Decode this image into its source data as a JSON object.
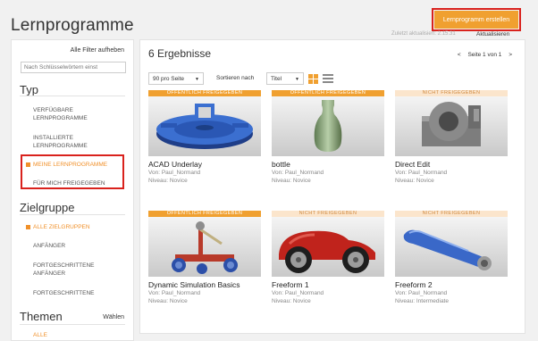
{
  "header": {
    "title": "Lernprogramme",
    "create_button": "Lernprogramm erstellen",
    "updated": "Zuletzt aktualisiert: 2.15.31",
    "refresh": "Aktualisieren"
  },
  "sidebar": {
    "clear_filters": "Alle Filter aufheben",
    "search_placeholder": "Nach Schlüsselwörtern einst",
    "type_title": "Typ",
    "type_items": [
      "VERFÜGBARE LERNPROGRAMME",
      "INSTALLIERTE LERNPROGRAMME",
      "MEINE LERNPROGRAMME",
      "FÜR MICH FREIGEGEBEN"
    ],
    "target_title": "Zielgruppe",
    "target_items": [
      "ALLE ZIELGRUPPEN",
      "ANFÄNGER",
      "FORTGESCHRITTENE ANFÄNGER",
      "FORTGESCHRITTENE"
    ],
    "themes_title": "Themen",
    "themes_choose": "Wählen",
    "themes_items": [
      "ALLE"
    ]
  },
  "main": {
    "results": "6 Ergebnisse",
    "pager_prev": "<",
    "pager_text": "Seite 1 von 1",
    "pager_next": ">",
    "per_page": "90 pro Seite",
    "sort_label": "Sortieren nach",
    "sort_value": "Titel",
    "cards": [
      {
        "banner": "ÖFFENTLICH FREIGEGEBEN",
        "title": "ACAD Underlay",
        "author": "Von: Paul_Normand",
        "level": "Niveau: Novice"
      },
      {
        "banner": "ÖFFENTLICH FREIGEGEBEN",
        "title": "bottle",
        "author": "Von: Paul_Normand",
        "level": "Niveau: Novice"
      },
      {
        "banner": "NICHT FREIGEGEBEN",
        "title": "Direct Edit",
        "author": "Von: Paul_Normand",
        "level": "Niveau: Novice"
      },
      {
        "banner": "ÖFFENTLICH FREIGEGEBEN",
        "title": "Dynamic Simulation Basics",
        "author": "Von: Paul_Normand",
        "level": "Niveau: Novice"
      },
      {
        "banner": "NICHT FREIGEGEBEN",
        "title": "Freeform 1",
        "author": "Von: Paul_Normand",
        "level": "Niveau: Novice"
      },
      {
        "banner": "NICHT FREIGEGEBEN",
        "title": "Freeform 2",
        "author": "Von: Paul_Normand",
        "level": "Niveau: Intermediate"
      }
    ]
  },
  "colors": {
    "accent": "#f0a030",
    "highlight": "#d9221d"
  }
}
